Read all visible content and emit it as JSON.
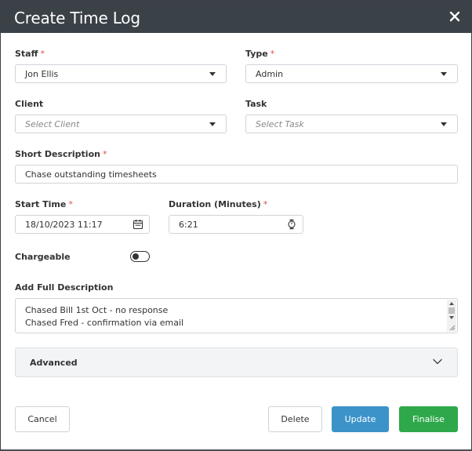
{
  "modal": {
    "title": "Create Time Log",
    "close_icon": "close-icon"
  },
  "form": {
    "staff": {
      "label": "Staff",
      "required": "*",
      "value": "Jon Ellis"
    },
    "type": {
      "label": "Type",
      "required": "*",
      "value": "Admin"
    },
    "client": {
      "label": "Client",
      "placeholder": "Select Client"
    },
    "task": {
      "label": "Task",
      "placeholder": "Select Task"
    },
    "short_description": {
      "label": "Short Description",
      "required": "*",
      "value": "Chase outstanding timesheets"
    },
    "start_time": {
      "label": "Start Time",
      "required": "*",
      "value": "18/10/2023 11:17",
      "icon": "calendar-icon"
    },
    "duration": {
      "label": "Duration (Minutes)",
      "required": "*",
      "value": "6:21",
      "icon": "stopwatch-icon"
    },
    "chargeable": {
      "label": "Chargeable",
      "enabled": false
    },
    "full_description": {
      "label": "Add Full Description",
      "lines": [
        "Chased Bill 1st Oct - no response",
        "Chased Fred - confirmation via email"
      ]
    },
    "advanced": {
      "label": "Advanced",
      "expanded": false
    }
  },
  "actions": {
    "cancel": "Cancel",
    "delete": "Delete",
    "update": "Update",
    "finalise": "Finalise"
  },
  "colors": {
    "header_bg": "#3a4147",
    "required": "#d9534f",
    "update_bg": "#3b93c9",
    "finalise_bg": "#2ea84a"
  }
}
